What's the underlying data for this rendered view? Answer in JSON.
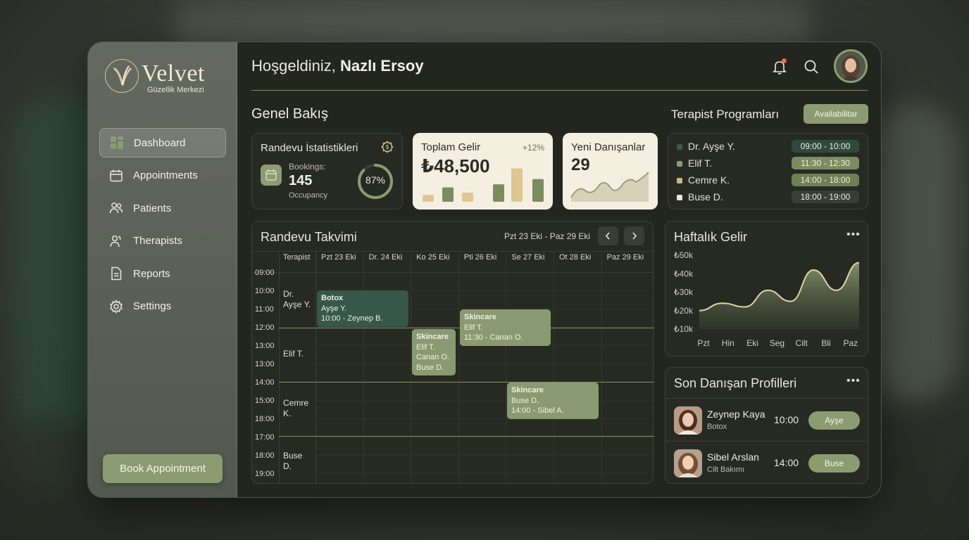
{
  "brand": {
    "name": "Velvet",
    "subtitle": "Güzellik Merkezi"
  },
  "sidebar": {
    "items": [
      {
        "label": "Dashboard",
        "icon": "dashboard-icon",
        "active": true
      },
      {
        "label": "Appointments",
        "icon": "calendar-icon",
        "active": false
      },
      {
        "label": "Patients",
        "icon": "users-icon",
        "active": false
      },
      {
        "label": "Therapists",
        "icon": "user-group-icon",
        "active": false
      },
      {
        "label": "Reports",
        "icon": "document-icon",
        "active": false
      },
      {
        "label": "Settings",
        "icon": "gear-icon",
        "active": false
      }
    ],
    "book_button": "Book Appointment"
  },
  "header": {
    "greeting": "Hoşgeldiniz,",
    "user_name": "Nazlı Ersoy"
  },
  "overview": {
    "title": "Genel Bakış",
    "stats": {
      "title": "Randevu İstatistikleri",
      "bookings_label": "Bookings:",
      "bookings_value": "145",
      "occupancy_label": "Occupancy",
      "occupancy_percent": "87%",
      "occupancy_fraction": 0.87
    },
    "revenue": {
      "title": "Toplam Gelir",
      "change": "+12%",
      "value": "₺48,500",
      "bars": [
        0.18,
        0.38,
        0.24,
        0.46,
        0.88,
        0.6
      ]
    },
    "new_clients": {
      "title": "Yeni Danışanlar",
      "value": "29"
    }
  },
  "therapist_schedule": {
    "title": "Terapist Programları",
    "button": "Availabilitar",
    "rows": [
      {
        "name": "Dr. Ayşe Y.",
        "time": "09:00 - 10:00",
        "color": "#3e5a4a",
        "time_bg": "#2f4a3c"
      },
      {
        "name": "Elif T.",
        "time": "11:30 - 12:30",
        "color": "#8c9c72",
        "time_bg": "#7d8c60"
      },
      {
        "name": "Cemre K.",
        "time": "14:00 - 18:00",
        "color": "#c9b68a",
        "time_bg": "#6f7e55"
      },
      {
        "name": "Buse D.",
        "time": "18:00 - 19:00",
        "color": "#efe6cf",
        "time_bg": "#3a3d36"
      }
    ]
  },
  "calendar": {
    "title": "Randevu Takvimi",
    "range": "Pzt 23 Eki - Paz 29 Eki",
    "therapist_col": "Terapist",
    "days": [
      "Pzt 23 Eki",
      "Dr. 24 Eki",
      "Ko 25 Eki",
      "Pti 26 Eki",
      "Se 27 Eki",
      "Ot 28 Eki",
      "Paz 29 Eki"
    ],
    "times": [
      "09:00",
      "10:00",
      "11:00",
      "12:00",
      "13:00",
      "13:00",
      "14:00",
      "15:00",
      "18:00",
      "17:00",
      "18:00",
      "19:00"
    ],
    "therapists": [
      "Dr.\nAyşe Y.",
      "Elif T.",
      "Cemre\nK.",
      "Buse\nD."
    ],
    "appointments": [
      {
        "title": "Botox",
        "lines": [
          "Ayşe Y.",
          "10:00 - Zeynep B."
        ],
        "color": "#36574a"
      },
      {
        "title": "Skincare",
        "lines": [
          "Elif T.",
          "Canan O.",
          "Buse D."
        ],
        "color": "#8a9a70"
      },
      {
        "title": "Skincare",
        "lines": [
          "Elif T.",
          "11:30 - Canan O."
        ],
        "color": "#8a9a70"
      },
      {
        "title": "Skincare",
        "lines": [
          "Buse D.",
          "14:00 - Sibel A."
        ],
        "color": "#8a9a70"
      }
    ]
  },
  "weekly_revenue": {
    "title": "Haftalık Gelir",
    "y_labels": [
      "₺50k",
      "₺40k",
      "₺30k",
      "₺20k",
      "₺10k"
    ],
    "x_labels": [
      "Pzt",
      "Hin",
      "Eki",
      "Seg",
      "Cilt",
      "Bli",
      "Paz"
    ]
  },
  "chart_data": {
    "type": "area",
    "title": "Haftalık Gelir",
    "x": [
      "Pzt",
      "Hin",
      "Eki",
      "Seg",
      "Cilt",
      "Bli",
      "Paz"
    ],
    "y_ticks": [
      "₺50k",
      "₺40k",
      "₺30k",
      "₺20k",
      "₺10k"
    ],
    "ylim": [
      10,
      50
    ],
    "series": [
      {
        "values": [
          20,
          24,
          22,
          31,
          25,
          42,
          31,
          46
        ]
      }
    ]
  },
  "recent_profiles": {
    "title": "Son Danışan Profilleri",
    "rows": [
      {
        "name": "Zeynep Kaya",
        "service": "Botox",
        "time": "10:00",
        "therapist": "Ayşe"
      },
      {
        "name": "Sibel Arslan",
        "service": "Cilt Bakımı",
        "time": "14:00",
        "therapist": "Buse"
      }
    ]
  },
  "colors": {
    "accent": "#8c9c72",
    "gold": "#d9c89a",
    "panel": "#23261f"
  }
}
